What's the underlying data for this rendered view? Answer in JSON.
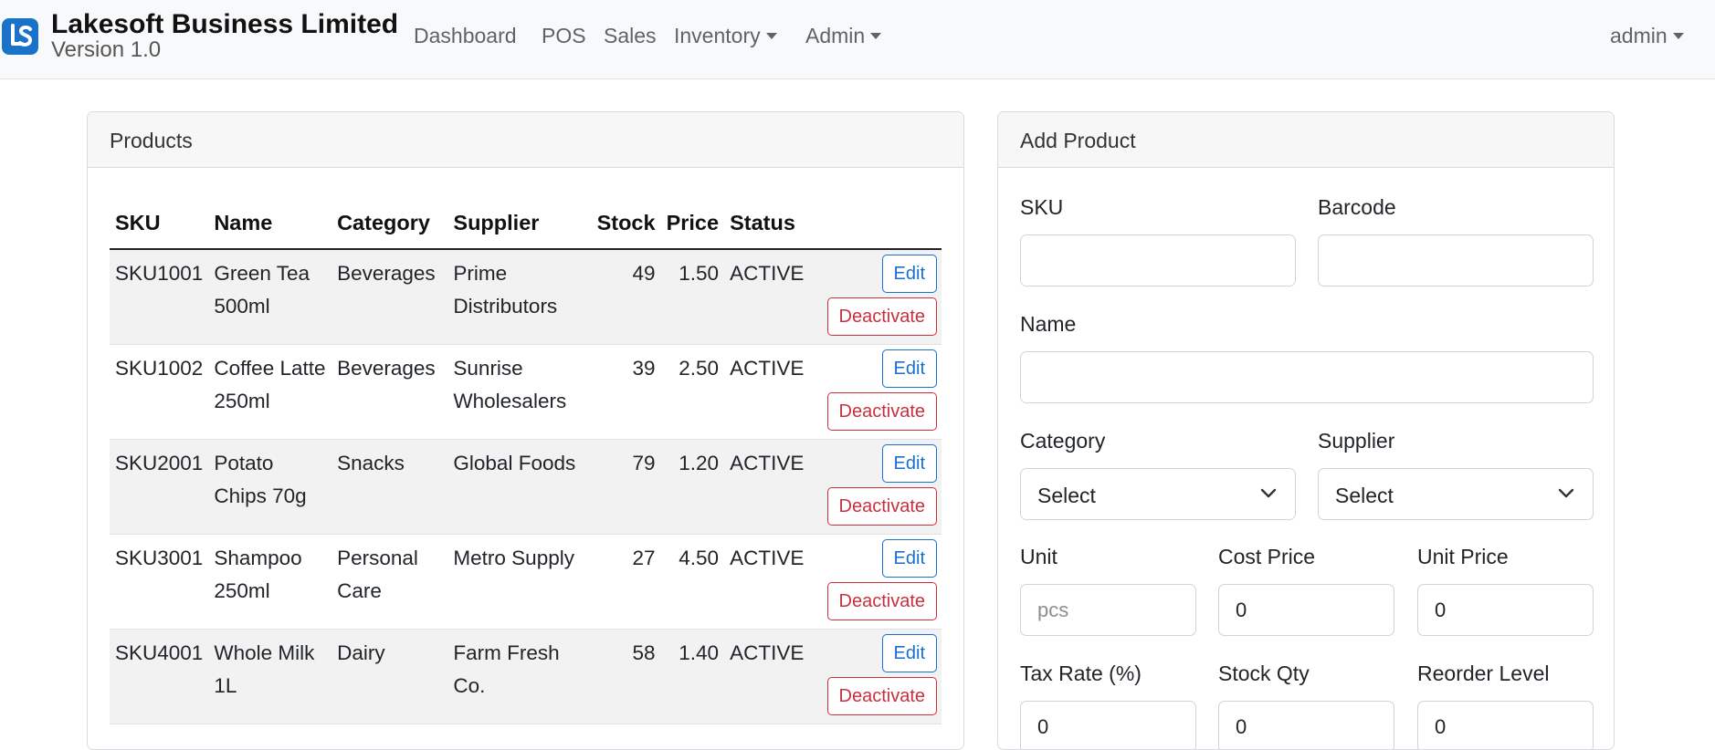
{
  "brand": {
    "title": "Lakesoft Business Limited",
    "version": "Version 1.0",
    "logo_icon": "ls-logo-icon",
    "logo_color": "#1a73c9"
  },
  "nav": {
    "dashboard": "Dashboard",
    "pos": "POS",
    "sales": "Sales",
    "inventory": "Inventory",
    "admin": "Admin",
    "user": "admin"
  },
  "products": {
    "header": "Products",
    "columns": [
      "SKU",
      "Name",
      "Category",
      "Supplier",
      "Stock",
      "Price",
      "Status"
    ],
    "edit_label": "Edit",
    "deactivate_label": "Deactivate",
    "rows": [
      {
        "sku": "SKU1001",
        "name": "Green Tea 500ml",
        "category": "Beverages",
        "supplier": "Prime Distributors",
        "stock": "49",
        "price": "1.50",
        "status": "ACTIVE"
      },
      {
        "sku": "SKU1002",
        "name": "Coffee Latte 250ml",
        "category": "Beverages",
        "supplier": "Sunrise Wholesalers",
        "stock": "39",
        "price": "2.50",
        "status": "ACTIVE"
      },
      {
        "sku": "SKU2001",
        "name": "Potato Chips 70g",
        "category": "Snacks",
        "supplier": "Global Foods",
        "stock": "79",
        "price": "1.20",
        "status": "ACTIVE"
      },
      {
        "sku": "SKU3001",
        "name": "Shampoo 250ml",
        "category": "Personal Care",
        "supplier": "Metro Supply",
        "stock": "27",
        "price": "4.50",
        "status": "ACTIVE"
      },
      {
        "sku": "SKU4001",
        "name": "Whole Milk 1L",
        "category": "Dairy",
        "supplier": "Farm Fresh Co.",
        "stock": "58",
        "price": "1.40",
        "status": "ACTIVE"
      }
    ]
  },
  "form": {
    "header": "Add Product",
    "sku": {
      "label": "SKU",
      "value": ""
    },
    "barcode": {
      "label": "Barcode",
      "value": ""
    },
    "name": {
      "label": "Name",
      "value": ""
    },
    "category": {
      "label": "Category",
      "selected": "Select"
    },
    "supplier": {
      "label": "Supplier",
      "selected": "Select"
    },
    "unit": {
      "label": "Unit",
      "value": "",
      "placeholder": "pcs"
    },
    "cost_price": {
      "label": "Cost Price",
      "value": "0"
    },
    "unit_price": {
      "label": "Unit Price",
      "value": "0"
    },
    "tax_rate": {
      "label": "Tax Rate (%)",
      "value": "0"
    },
    "stock_qty": {
      "label": "Stock Qty",
      "value": "0"
    },
    "reorder_level": {
      "label": "Reorder Level",
      "value": "0"
    }
  },
  "colors": {
    "primary": "#1a6fd0",
    "danger": "#c9303f",
    "navbar_bg": "#f8f9fa",
    "stripe": "#f2f2f2"
  }
}
